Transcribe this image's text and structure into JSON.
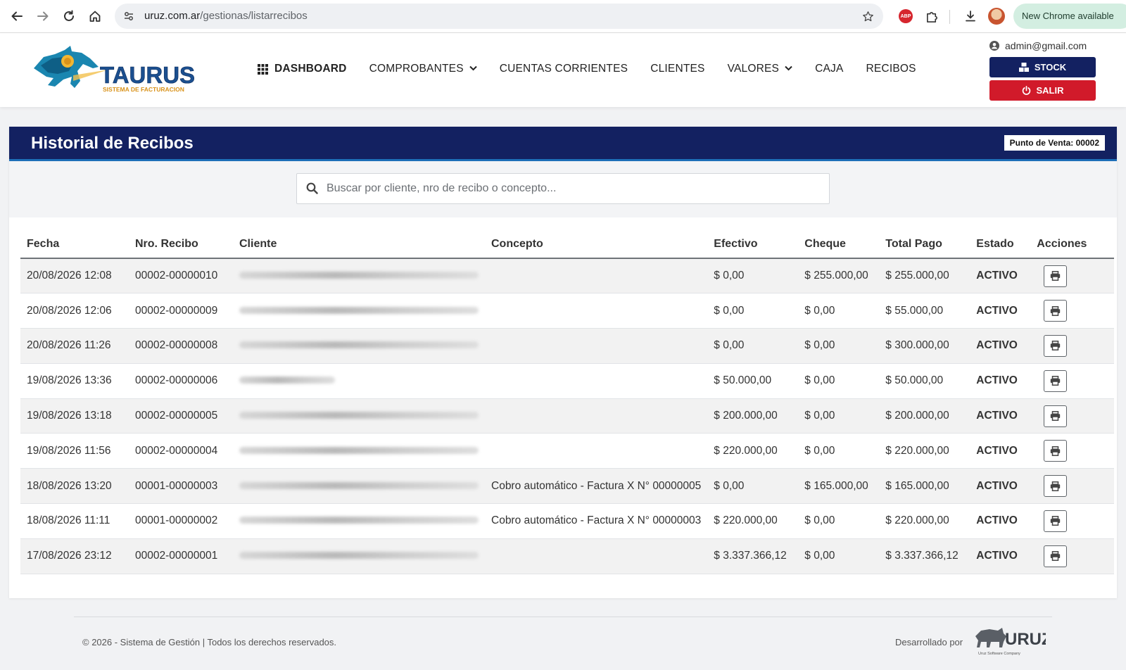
{
  "browser": {
    "url_domain": "uruz.com.ar",
    "url_path": "/gestionas/listarrecibos",
    "new_chrome_label": "New Chrome available",
    "abp_label": "ABP"
  },
  "header": {
    "logo_text": "TAURUS",
    "logo_subtitle": "SISTEMA DE FACTURACION",
    "nav": [
      {
        "label": "DASHBOARD",
        "active": true
      },
      {
        "label": "COMPROBANTES",
        "dropdown": true
      },
      {
        "label": "CUENTAS CORRIENTES"
      },
      {
        "label": "CLIENTES"
      },
      {
        "label": "VALORES",
        "dropdown": true
      },
      {
        "label": "CAJA"
      },
      {
        "label": "RECIBOS"
      }
    ],
    "user_email": "admin@gmail.com",
    "stock_label": "STOCK",
    "salir_label": "SALIR"
  },
  "card": {
    "title": "Historial de Recibos",
    "punto_venta": "Punto de Venta: 00002",
    "search_placeholder": "Buscar por cliente, nro de recibo o concepto..."
  },
  "table": {
    "columns": [
      "Fecha",
      "Nro. Recibo",
      "Cliente",
      "Concepto",
      "Efectivo",
      "Cheque",
      "Total Pago",
      "Estado",
      "Acciones"
    ],
    "rows": [
      {
        "fecha": "20/08/2026 12:08",
        "nro": "00002-00000010",
        "concepto": "",
        "efectivo": "$ 0,00",
        "cheque": "$ 255.000,00",
        "total": "$ 255.000,00",
        "estado": "ACTIVO"
      },
      {
        "fecha": "20/08/2026 12:06",
        "nro": "00002-00000009",
        "concepto": "",
        "efectivo": "$ 0,00",
        "cheque": "$ 0,00",
        "total": "$ 55.000,00",
        "estado": "ACTIVO"
      },
      {
        "fecha": "20/08/2026 11:26",
        "nro": "00002-00000008",
        "concepto": "",
        "efectivo": "$ 0,00",
        "cheque": "$ 0,00",
        "total": "$ 300.000,00",
        "estado": "ACTIVO"
      },
      {
        "fecha": "19/08/2026 13:36",
        "nro": "00002-00000006",
        "concepto": "",
        "efectivo": "$ 50.000,00",
        "cheque": "$ 0,00",
        "total": "$ 50.000,00",
        "estado": "ACTIVO"
      },
      {
        "fecha": "19/08/2026 13:18",
        "nro": "00002-00000005",
        "concepto": "",
        "efectivo": "$ 200.000,00",
        "cheque": "$ 0,00",
        "total": "$ 200.000,00",
        "estado": "ACTIVO"
      },
      {
        "fecha": "19/08/2026 11:56",
        "nro": "00002-00000004",
        "concepto": "",
        "efectivo": "$ 220.000,00",
        "cheque": "$ 0,00",
        "total": "$ 220.000,00",
        "estado": "ACTIVO"
      },
      {
        "fecha": "18/08/2026 13:20",
        "nro": "00001-00000003",
        "concepto": "Cobro automático - Factura X N° 00000005",
        "efectivo": "$ 0,00",
        "cheque": "$ 165.000,00",
        "total": "$ 165.000,00",
        "estado": "ACTIVO"
      },
      {
        "fecha": "18/08/2026 11:11",
        "nro": "00001-00000002",
        "concepto": "Cobro automático - Factura X N° 00000003",
        "efectivo": "$ 220.000,00",
        "cheque": "$ 0,00",
        "total": "$ 220.000,00",
        "estado": "ACTIVO"
      },
      {
        "fecha": "17/08/2026 23:12",
        "nro": "00002-00000001",
        "concepto": "",
        "efectivo": "$ 3.337.366,12",
        "cheque": "$ 0,00",
        "total": "$ 3.337.366,12",
        "estado": "ACTIVO"
      }
    ]
  },
  "footer": {
    "copyright": "© 2026 - Sistema de Gestión | Todos los derechos reservados.",
    "developed_by": "Desarrollado por",
    "dev_logo_text": "URUZ",
    "dev_logo_subtitle": "Uruz Software Company"
  },
  "colors": {
    "brand_navy": "#132161",
    "danger": "#d11a2a",
    "efectivo_green": "#1a8a3f",
    "cheque_cyan": "#1aaed6"
  }
}
